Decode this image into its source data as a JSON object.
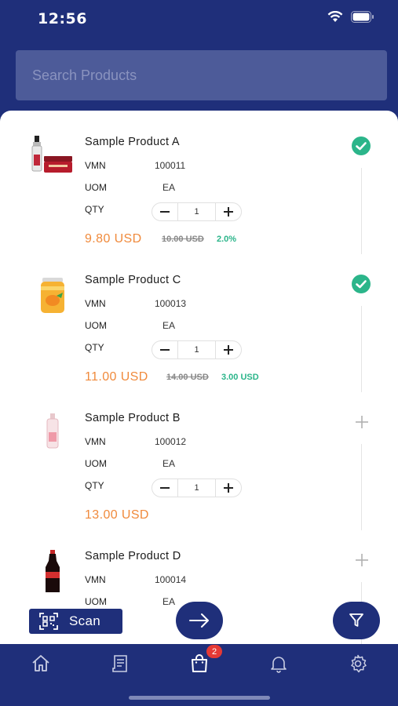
{
  "status": {
    "time": "12:56"
  },
  "search": {
    "placeholder": "Search Products"
  },
  "labels": {
    "vmn": "VMN",
    "uom": "UOM",
    "qty": "QTY"
  },
  "products": [
    {
      "name": "Sample Product A",
      "vmn": "100011",
      "uom": "EA",
      "qty": "1",
      "price": "9.80 USD",
      "old_price": "10.00 USD",
      "discount": "2.0%",
      "selected": true,
      "image": "serum-cream-icon"
    },
    {
      "name": "Sample Product C",
      "vmn": "100013",
      "uom": "EA",
      "qty": "1",
      "price": "11.00 USD",
      "old_price": "14.00 USD",
      "discount": "3.00 USD",
      "selected": true,
      "image": "juice-can-icon"
    },
    {
      "name": "Sample Product B",
      "vmn": "100012",
      "uom": "EA",
      "qty": "1",
      "price": "13.00 USD",
      "selected": false,
      "image": "lotion-bottle-icon"
    },
    {
      "name": "Sample Product D",
      "vmn": "100014",
      "uom": "EA",
      "selected": false,
      "image": "cola-bottle-icon"
    }
  ],
  "actions": {
    "scan_label": "Scan"
  },
  "tabbar": {
    "cart_badge": "2",
    "items": [
      "home-icon",
      "receipt-icon",
      "shopping-bag-icon",
      "bell-icon",
      "gear-icon"
    ]
  },
  "colors": {
    "brand": "#1f2f7a",
    "price": "#f08a3c",
    "discount": "#2bb58a",
    "check": "#2bb58a",
    "badge": "#e53935"
  }
}
